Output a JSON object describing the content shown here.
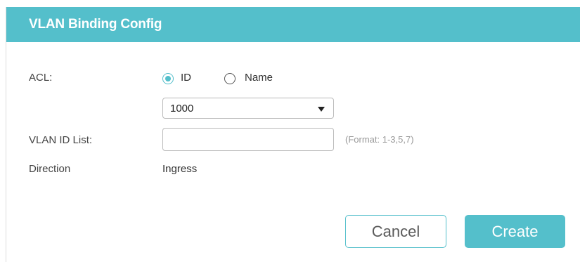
{
  "dialog": {
    "title": "VLAN Binding Config"
  },
  "acl": {
    "label": "ACL:",
    "options": [
      {
        "label": "ID",
        "selected": true
      },
      {
        "label": "Name",
        "selected": false
      }
    ],
    "select_value": "1000"
  },
  "vlan_id_list": {
    "label": "VLAN ID List:",
    "value": "",
    "placeholder": "",
    "hint": "(Format: 1-3,5,7)"
  },
  "direction": {
    "label": "Direction",
    "value": "Ingress"
  },
  "buttons": {
    "cancel": "Cancel",
    "create": "Create"
  },
  "colors": {
    "accent": "#54bfcb",
    "text": "#333333",
    "hint": "#999999"
  },
  "icons": {
    "select_caret": "chevron-down-icon"
  }
}
